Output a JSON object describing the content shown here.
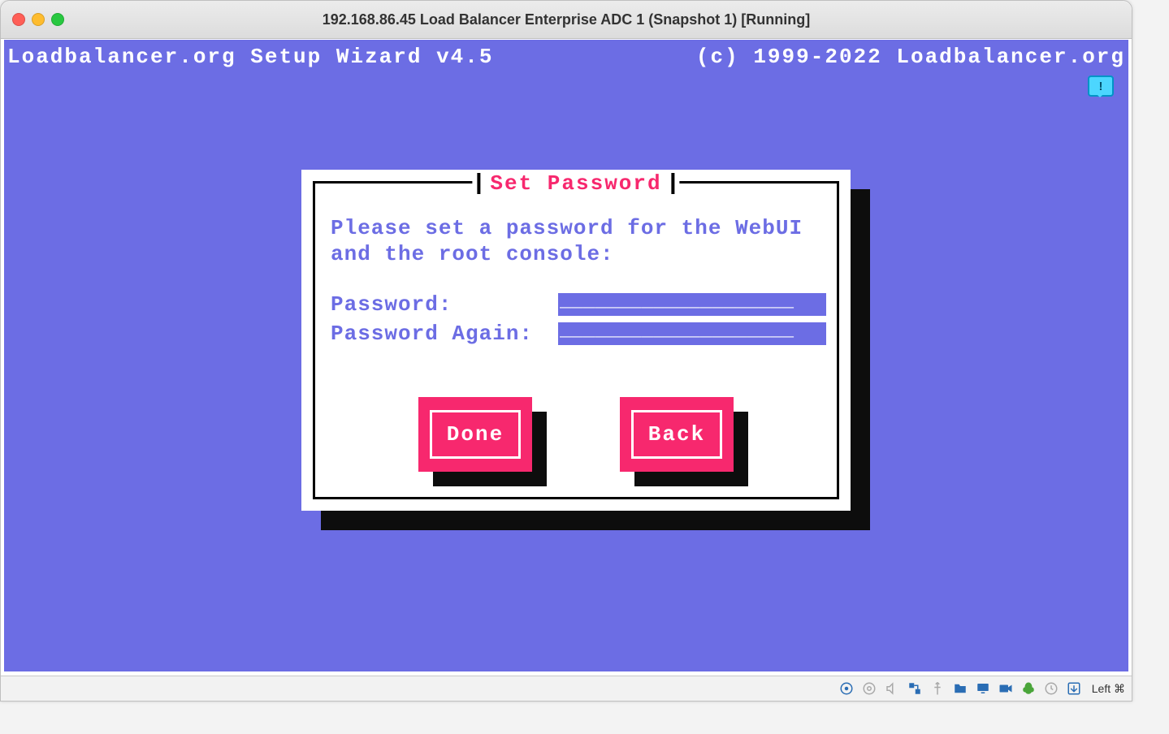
{
  "window": {
    "title": "192.168.86.45 Load Balancer Enterprise ADC 1 (Snapshot 1) [Running]"
  },
  "console": {
    "header_left": "Loadbalancer.org Setup Wizard v4.5",
    "header_right": "(c) 1999-2022 Loadbalancer.org",
    "notify_glyph": "!"
  },
  "dialog": {
    "title": "Set Password",
    "message_line1": "Please set a password for the WebUI",
    "message_line2": "and the root console:",
    "password_label": "Password:",
    "password_again_label": "Password Again:",
    "password_value": "",
    "password_again_value": "",
    "field_underscores": "____________________",
    "done_label": "Done",
    "back_label": "Back"
  },
  "statusbar": {
    "host_key_label": "Left ⌘"
  }
}
